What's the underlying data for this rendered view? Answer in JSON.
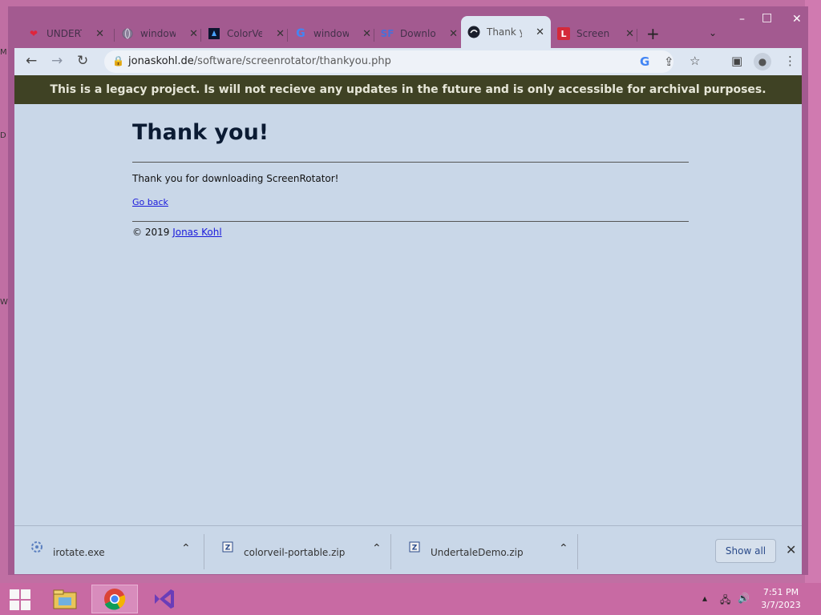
{
  "desktop": {
    "glyphs": [
      "M",
      "D",
      "W"
    ]
  },
  "window_controls": {
    "minimize": "–",
    "maximize": "□",
    "close": "✕"
  },
  "tabs": [
    {
      "title": "UNDERTALE",
      "icon": "heart-icon",
      "active": false
    },
    {
      "title": "windows",
      "icon": "globe-icon",
      "active": false
    },
    {
      "title": "ColorVeil",
      "icon": "colorveil-icon",
      "active": false
    },
    {
      "title": "windows",
      "icon": "google-icon",
      "active": false
    },
    {
      "title": "Downloads",
      "icon": "sourceforge-icon",
      "active": false
    },
    {
      "title": "Thank you",
      "icon": "site-icon",
      "active": true
    },
    {
      "title": "Screen R",
      "icon": "letter-l-icon",
      "active": false
    }
  ],
  "tab_close": "✕",
  "new_tab": "+",
  "address": {
    "host": "jonaskohl.de",
    "path": "/software/screenrotator/thankyou.php"
  },
  "page": {
    "banner": "This is a legacy project. Is will not recieve any updates in the future and is only accessible for archival purposes.",
    "title": "Thank you!",
    "message": "Thank you for downloading ScreenRotator!",
    "back_link": "Go back",
    "copyright": "© 2019",
    "author_link": "Jonas Kohl"
  },
  "downloads": {
    "items": [
      {
        "name": "irotate.exe",
        "icon": "exe-icon"
      },
      {
        "name": "colorveil-portable.zip",
        "icon": "zip-icon"
      },
      {
        "name": "UndertaleDemo.zip",
        "icon": "zip-icon"
      }
    ],
    "show_all": "Show all"
  },
  "taskbar": {
    "time": "7:51 PM",
    "date": "3/7/2023"
  },
  "colors": {
    "banner_bg": "#3f4224",
    "page_bg": "#c9d7e8",
    "link": "#1a1adb",
    "taskbar": "#c86aa3"
  }
}
